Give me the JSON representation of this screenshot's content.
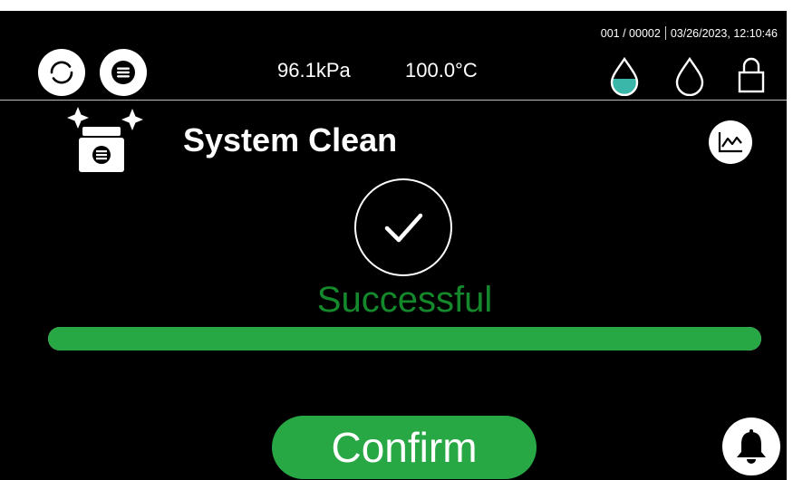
{
  "header": {
    "counter": "001 / 00002",
    "datetime": "03/26/2023, 12:10:46",
    "pressure": "96.1kPa",
    "temperature": "100.0°C"
  },
  "title": "System Clean",
  "result_text": "Successful",
  "progress": 1.0,
  "confirm_label": "Confirm",
  "colors": {
    "accent_green": "#28a745",
    "success_text": "#14892c",
    "water_fill": "#3bb7a9",
    "background": "#000000"
  },
  "icons": [
    "refresh-icon",
    "menu-icon",
    "water-level-icon",
    "water-drop-icon",
    "lock-icon",
    "system-clean-icon",
    "chart-icon",
    "checkmark-icon",
    "bell-icon"
  ]
}
